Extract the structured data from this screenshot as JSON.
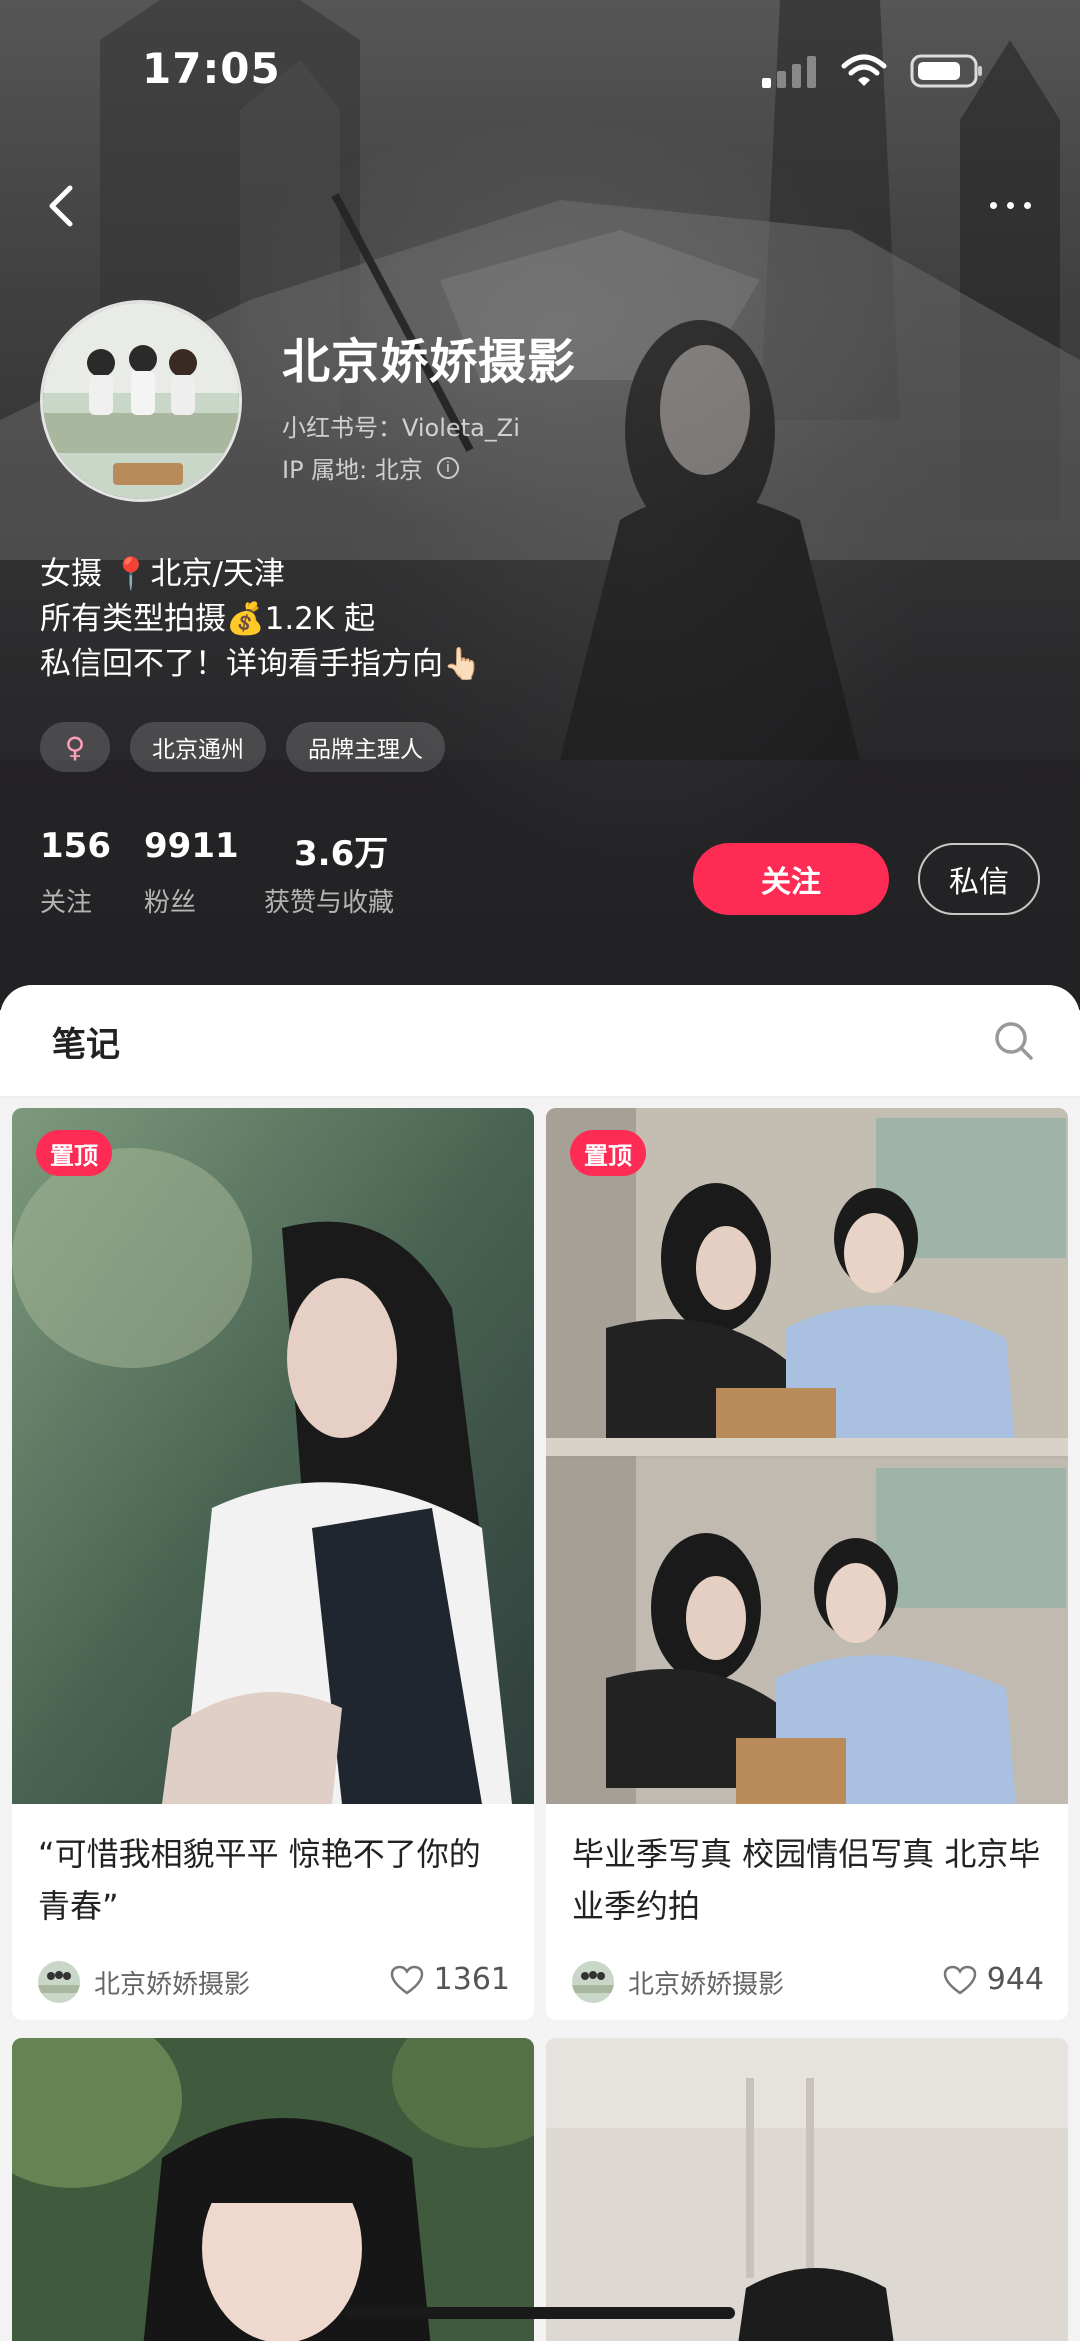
{
  "status_bar": {
    "time": "17:05"
  },
  "profile": {
    "nickname": "北京娇娇摄影",
    "red_id": "小红书号：Violeta_Zi",
    "ip_location": "IP 属地: 北京",
    "bio_lines": [
      "女摄 📍北京/天津",
      "所有类型拍摄💰1.2K 起",
      "私信回不了！详询看手指方向👆🏻"
    ],
    "tags": [
      {
        "label": "♀",
        "icon": "female-icon"
      },
      {
        "label": "北京通州"
      },
      {
        "label": "品牌主理人"
      }
    ],
    "stats": [
      {
        "value": "156",
        "label": "关注"
      },
      {
        "value": "9911",
        "label": "粉丝"
      },
      {
        "value": "3.6万",
        "label": "获赞与收藏"
      }
    ],
    "follow_label": "关注",
    "message_label": "私信"
  },
  "notes_section": {
    "tab_label": "笔记",
    "search_icon": "search-icon"
  },
  "notes": [
    {
      "pinned_label": "置顶",
      "title": "“可惜我相貌平平 惊艳不了你的青春”",
      "author": "北京娇娇摄影",
      "likes": "1361"
    },
    {
      "pinned_label": "置顶",
      "title": "毕业季写真 校园情侣写真 北京毕业季约拍",
      "author": "北京娇娇摄影",
      "likes": "944"
    },
    {
      "pinned_label": "",
      "title": "",
      "author": "",
      "likes": ""
    },
    {
      "pinned_label": "",
      "title": "",
      "author": "",
      "likes": ""
    }
  ],
  "colors": {
    "accent": "#fe2c55",
    "header_bg": "#2a292c",
    "page_bg": "#f3f3f3"
  }
}
